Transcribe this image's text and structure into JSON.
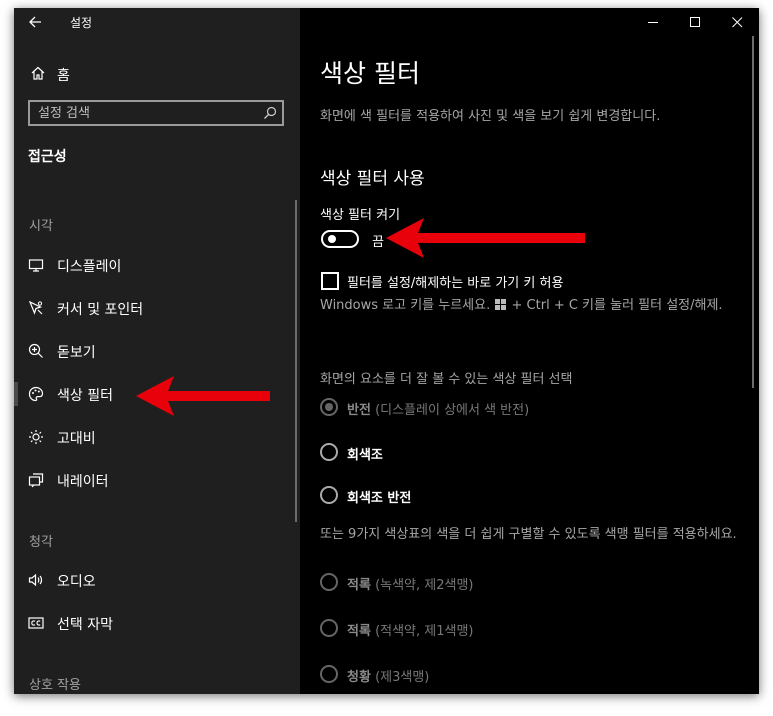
{
  "window": {
    "title": "설정"
  },
  "sidebar": {
    "home_label": "홈",
    "search_placeholder": "설정 검색",
    "category": "접근성",
    "sections": [
      {
        "label": "시각"
      },
      {
        "label": "청각"
      },
      {
        "label": "상호 작용"
      }
    ],
    "items": [
      {
        "label": "디스플레이",
        "icon": "display-icon"
      },
      {
        "label": "커서 및 포인터",
        "icon": "cursor-icon"
      },
      {
        "label": "돋보기",
        "icon": "magnifier-icon"
      },
      {
        "label": "색상 필터",
        "icon": "palette-icon",
        "selected": true
      },
      {
        "label": "고대비",
        "icon": "sun-contrast-icon"
      },
      {
        "label": "내레이터",
        "icon": "narrator-icon"
      },
      {
        "label": "오디오",
        "icon": "speaker-icon"
      },
      {
        "label": "선택 자막",
        "icon": "caption-icon"
      }
    ]
  },
  "main": {
    "title": "색상 필터",
    "description": "화면에 색 필터를 적용하여 사진 및 색을 보기 쉽게 변경합니다.",
    "subtitle": "색상 필터 사용",
    "toggle": {
      "label": "색상 필터 켜기",
      "state": "끔",
      "on": false
    },
    "shortcut_checkbox": {
      "label": "필터를 설정/해제하는 바로 가기 키 허용",
      "checked": false
    },
    "shortcut_desc_before": "Windows 로고 키를 누르세요.",
    "shortcut_desc_after": "+ Ctrl + C 키를 눌러 필터 설정/해제.",
    "filter_group_label": "화면의 요소를 더 잘 볼 수 있는 색상 필터 선택",
    "filter_options": [
      {
        "name": "반전",
        "sub": "(디스플레이 상에서 색 반전)",
        "selected": true
      },
      {
        "name": "회색조",
        "sub": "",
        "selected": false
      },
      {
        "name": "회색조 반전",
        "sub": "",
        "selected": false
      }
    ],
    "colorblind_group_label": "또는 9가지 색상표의 색을 더 쉽게 구별할 수 있도록 색맹 필터를 적용하세요.",
    "colorblind_options": [
      {
        "name": "적록",
        "sub": "(녹색약, 제2색맹)"
      },
      {
        "name": "적록",
        "sub": "(적색약, 제1색맹)"
      },
      {
        "name": "청황",
        "sub": "(제3색맹)"
      }
    ]
  },
  "colors": {
    "accent_arrow": "#e8000b",
    "sidebar_bg": "#1f1f1f",
    "content_bg": "#000000"
  }
}
